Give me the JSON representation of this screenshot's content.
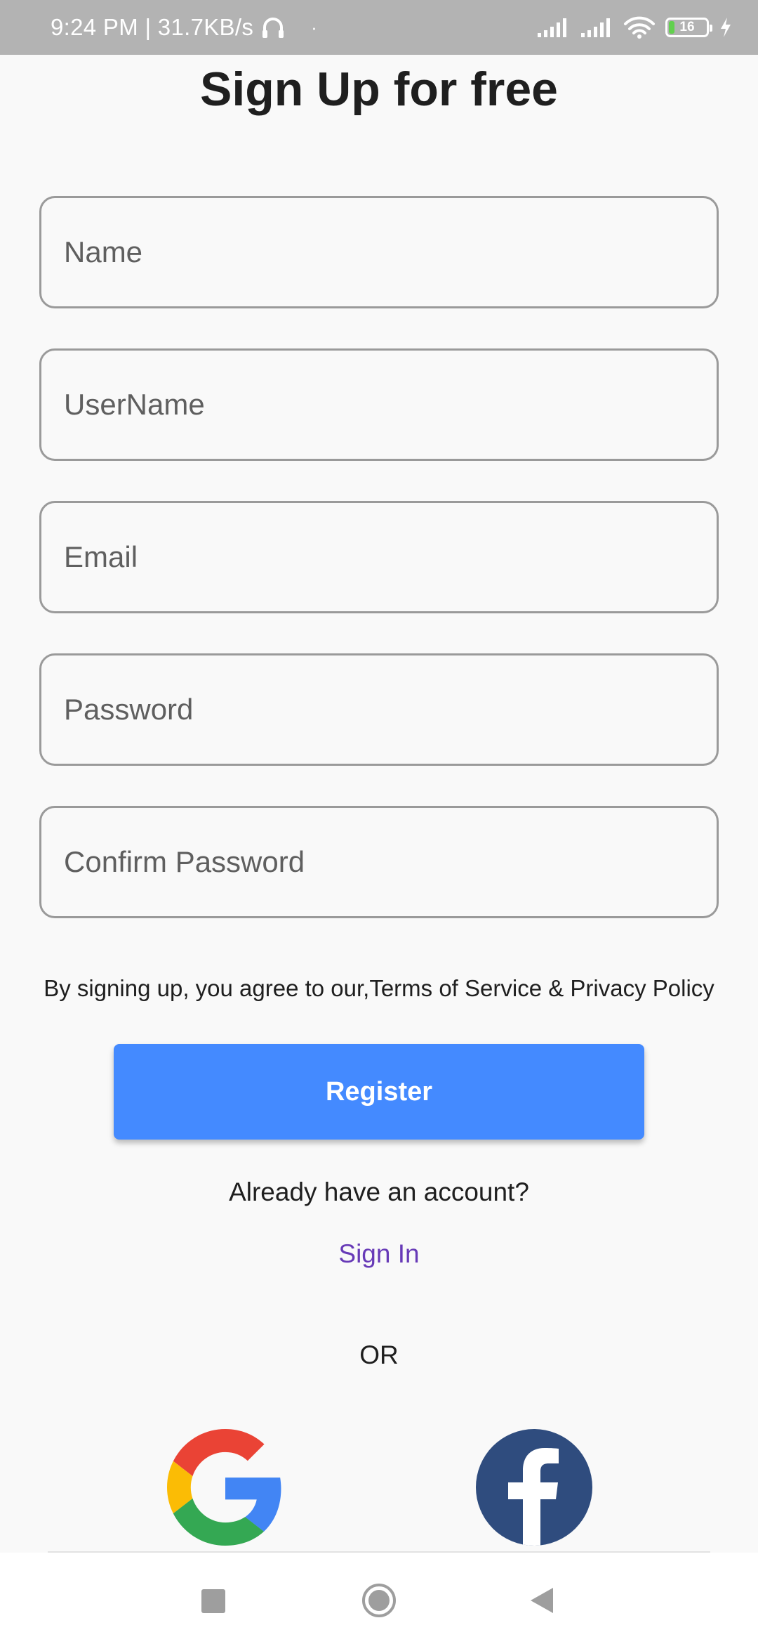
{
  "status_bar": {
    "time_speed": "9:24 PM | 31.7KB/s",
    "dot": "·",
    "battery_level": "16",
    "battery_fraction": 0.16
  },
  "page": {
    "title": "Sign Up for free"
  },
  "form": {
    "name_placeholder": "Name",
    "username_placeholder": "UserName",
    "email_placeholder": "Email",
    "password_placeholder": "Password",
    "confirm_password_placeholder": "Confirm Password",
    "terms_text": "By signing up, you agree to our,Terms of Service & Privacy Policy",
    "register_label": "Register"
  },
  "signin": {
    "prompt": "Already have an account?",
    "link_label": "Sign In"
  },
  "social": {
    "or_label": "OR",
    "google_icon": "google-icon",
    "facebook_icon": "facebook-icon"
  },
  "colors": {
    "primary": "#448aff",
    "link": "#673ab7",
    "facebook": "#2f4c7e",
    "status_bar": "#b3b3b3"
  }
}
